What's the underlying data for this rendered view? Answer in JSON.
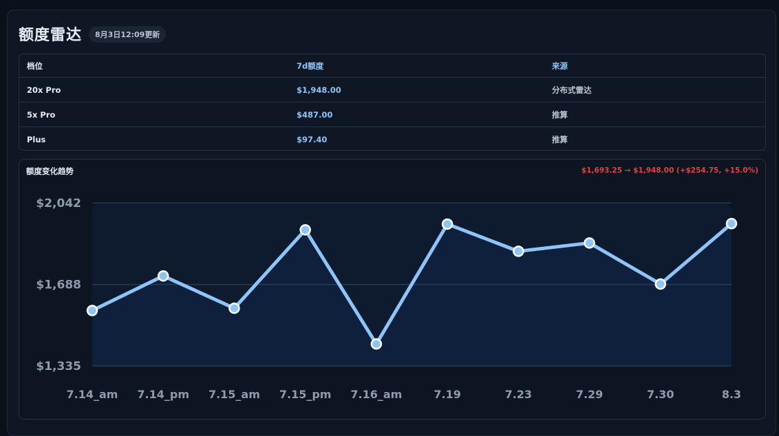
{
  "header": {
    "title": "额度雷达",
    "updated": "8月3日12:09更新"
  },
  "table": {
    "headers": {
      "tier": "档位",
      "quota": "7d额度",
      "source": "来源"
    },
    "rows": [
      {
        "tier": "20x Pro",
        "quota": "$1,948.00",
        "source": "分布式雷达"
      },
      {
        "tier": "5x Pro",
        "quota": "$487.00",
        "source": "推算"
      },
      {
        "tier": "Plus",
        "quota": "$97.40",
        "source": "推算"
      }
    ]
  },
  "chart": {
    "title": "额度变化趋势",
    "change_text": "$1,693.25 → $1,948.00 (+$254.75, +15.0%)"
  },
  "colors": {
    "line": "#8ec4f7",
    "fill": "#0f2240",
    "change": "#e0443f",
    "grid": "#2a3a50"
  },
  "chart_data": {
    "type": "area",
    "categories": [
      "7.14_am",
      "7.14_pm",
      "7.15_am",
      "7.15_pm",
      "7.16_am",
      "7.19",
      "7.23",
      "7.29",
      "7.30",
      "8.3"
    ],
    "values": [
      1575,
      1725,
      1585,
      1925,
      1430,
      1950,
      1832,
      1868,
      1690,
      1952
    ],
    "ylim": [
      1335,
      2042
    ],
    "yticks": [
      "$1,335",
      "$1,688",
      "$2,042"
    ],
    "ytick_values": [
      1335,
      1688,
      2042
    ],
    "grid": true,
    "legend": "none"
  }
}
